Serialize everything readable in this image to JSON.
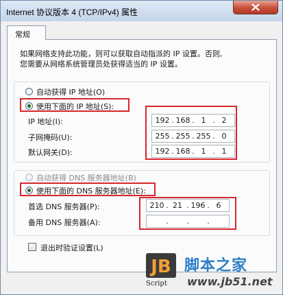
{
  "window": {
    "title": "Internet 协议版本 4 (TCP/IPv4) 属性"
  },
  "tabs": [
    {
      "label": "常规"
    }
  ],
  "description": {
    "line1": "如果网络支持此功能，则可以获取自动指派的 IP 设置。否则,",
    "line2": "您需要从网络系统管理员处获得适当的 IP 设置。"
  },
  "ip_section": {
    "auto_label": "自动获得 IP 地址(O)",
    "manual_label": "使用下面的 IP 地址(S):",
    "selected": "manual",
    "fields": [
      {
        "label": "IP 地址(I):",
        "octets": [
          "192",
          "168",
          "1",
          "2"
        ]
      },
      {
        "label": "子网掩码(U):",
        "octets": [
          "255",
          "255",
          "255",
          "0"
        ]
      },
      {
        "label": "默认网关(D):",
        "octets": [
          "192",
          "168",
          "1",
          "1"
        ]
      }
    ]
  },
  "dns_section": {
    "auto_label": "自动获得 DNS 服务器地址(B)",
    "manual_label": "使用下面的 DNS 服务器地址(E):",
    "selected": "manual",
    "fields": [
      {
        "label": "首选 DNS 服务器(P):",
        "octets": [
          "210",
          "21",
          "196",
          "6"
        ]
      },
      {
        "label": "备用 DNS 服务器(A):",
        "octets": [
          "",
          "",
          "",
          ""
        ]
      }
    ]
  },
  "validate_checkbox": {
    "label": "退出时验证设置(L)",
    "checked": false
  },
  "watermark": {
    "logo_text": "JB",
    "logo_caption": "Script",
    "brand_cn": "脚本之家",
    "brand_url": "www.jb51.net"
  },
  "colors": {
    "highlight_border": "#d8262b",
    "title_gradient_top": "#dfe9f5",
    "close_button": "#c74f3a"
  }
}
